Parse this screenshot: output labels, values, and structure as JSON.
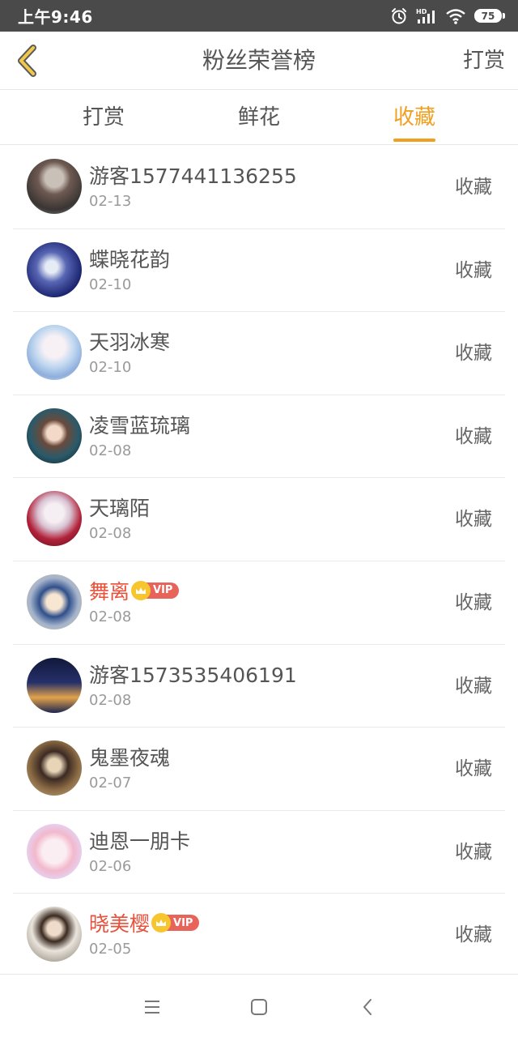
{
  "status_bar": {
    "time": "上午9:46",
    "battery": "75",
    "icons": [
      "alarm-icon",
      "hd-signal-icon",
      "wifi-icon",
      "battery-icon"
    ]
  },
  "header": {
    "back_icon": "chevron-left-icon",
    "title": "粉丝荣誉榜",
    "action_label": "打赏"
  },
  "tabs": [
    {
      "label": "打赏",
      "active": false
    },
    {
      "label": "鲜花",
      "active": false
    },
    {
      "label": "收藏",
      "active": true
    }
  ],
  "list": [
    {
      "name": "游客1577441136255",
      "date": "02-13",
      "type": "收藏",
      "vip": false
    },
    {
      "name": "蝶晓花韵",
      "date": "02-10",
      "type": "收藏",
      "vip": false
    },
    {
      "name": "天羽冰寒",
      "date": "02-10",
      "type": "收藏",
      "vip": false
    },
    {
      "name": "凌雪蓝琉璃",
      "date": "02-08",
      "type": "收藏",
      "vip": false
    },
    {
      "name": "天璃陌",
      "date": "02-08",
      "type": "收藏",
      "vip": false
    },
    {
      "name": "舞离",
      "date": "02-08",
      "type": "收藏",
      "vip": true,
      "vip_label": "VIP"
    },
    {
      "name": "游客1573535406191",
      "date": "02-08",
      "type": "收藏",
      "vip": false
    },
    {
      "name": "鬼墨夜魂",
      "date": "02-07",
      "type": "收藏",
      "vip": false
    },
    {
      "name": "迪恩一朋卡",
      "date": "02-06",
      "type": "收藏",
      "vip": false
    },
    {
      "name": "晓美樱",
      "date": "02-05",
      "type": "收藏",
      "vip": true,
      "vip_label": "VIP"
    }
  ],
  "colors": {
    "accent": "#f0a020",
    "vip_name": "#e8513b",
    "status_bar": "#4a4a4a"
  },
  "system_nav": [
    "menu-icon",
    "home-icon",
    "back-icon"
  ]
}
